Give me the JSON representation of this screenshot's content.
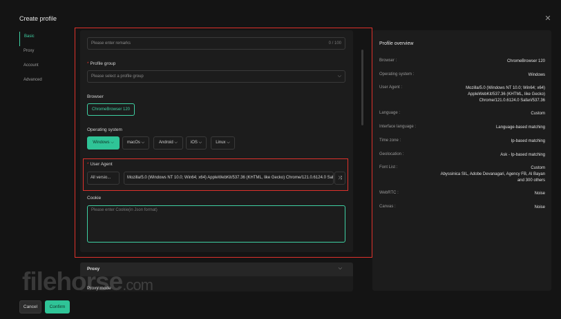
{
  "header": {
    "title": "Create profile",
    "close_glyph": "✕"
  },
  "nav": {
    "items": [
      {
        "label": "Basic",
        "active": true
      },
      {
        "label": "Proxy",
        "active": false
      },
      {
        "label": "Account",
        "active": false
      },
      {
        "label": "Advanced",
        "active": false
      }
    ]
  },
  "form": {
    "remarks": {
      "placeholder": "Please enter remarks",
      "counter": "0 / 100"
    },
    "profile_group": {
      "required_mark": "*",
      "label": "Profile group",
      "placeholder": "Please select a profile group"
    },
    "browser": {
      "label": "Browser",
      "value": "ChromeBrowser 120"
    },
    "os": {
      "label": "Operating system",
      "options": [
        "Windows",
        "macOs",
        "Android",
        "iOS",
        "Linux"
      ],
      "selected": "Windows"
    },
    "user_agent": {
      "required_mark": "*",
      "label": "User Agent",
      "version_select": "All versio...",
      "value": "Mozilla/5.0 (Windows NT 10.0; Win64; x64) AppleWebKit/537.36 (KHTML, like Gecko) Chrome/121.0.6124.0 Safari/537.36"
    },
    "cookie": {
      "label": "Cookie",
      "placeholder": "Please enter Cookie(in Json format)"
    }
  },
  "proxy_section": {
    "title": "Proxy",
    "mode_label": "Proxy mode"
  },
  "overview": {
    "title": "Profile overview",
    "rows": [
      {
        "key": "Browser :",
        "value": "ChromeBrowser 120"
      },
      {
        "key": "Operating system :",
        "value": "Windows"
      },
      {
        "key": "User Agent :",
        "value": "Mozilla/5.0 (Windows NT 10.0; Win64; x64)\nAppleWebKit/537.36 (KHTML, like Gecko)\nChrome/121.0.6124.0 Safari/537.36"
      },
      {
        "key": "Language :",
        "value": "Custom"
      },
      {
        "key": "Interface language :",
        "value": "Language-based matching"
      },
      {
        "key": "Time zone :",
        "value": "Ip-based matching"
      },
      {
        "key": "Geolocation :",
        "value": "Ask - Ip-based matching"
      },
      {
        "key": "Font List :",
        "value": "Custom\nAbyssinica SIL, Adobe Devanagari, Agency FB, Al Bayan\nand 300 others"
      },
      {
        "key": "WebRTC :",
        "value": "Noise"
      },
      {
        "key": "Canvas :",
        "value": "Noise"
      }
    ]
  },
  "footer": {
    "cancel_label": "Cancel",
    "confirm_label": "Confirm"
  },
  "watermark": {
    "brand": "filehorse",
    "domain": ".com"
  },
  "colors": {
    "accent": "#2fc497",
    "highlight_frame": "#e0322c",
    "background": "#141414",
    "panel": "#1c1c1c"
  }
}
